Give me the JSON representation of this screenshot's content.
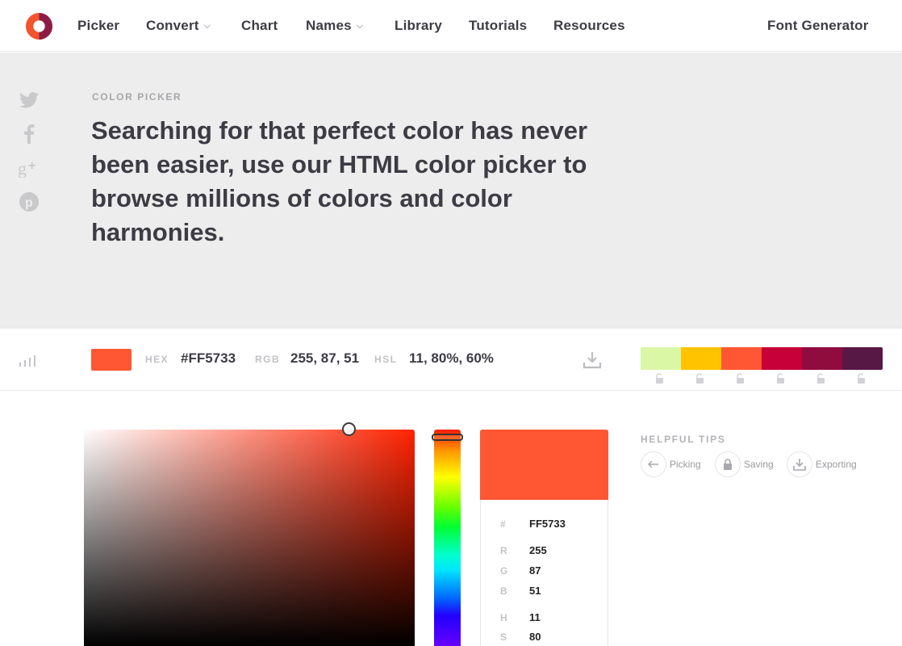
{
  "nav": {
    "items": [
      {
        "label": "Picker",
        "has_dropdown": false
      },
      {
        "label": "Convert",
        "has_dropdown": true
      },
      {
        "label": "Chart",
        "has_dropdown": false
      },
      {
        "label": "Names",
        "has_dropdown": true
      },
      {
        "label": "Library",
        "has_dropdown": false
      },
      {
        "label": "Tutorials",
        "has_dropdown": false
      },
      {
        "label": "Resources",
        "has_dropdown": false
      }
    ],
    "right_link": "Font Generator",
    "logo_icon": "logo-icon"
  },
  "social": [
    "twitter-icon",
    "facebook-icon",
    "google-plus-icon",
    "pinterest-icon"
  ],
  "hero": {
    "eyebrow": "COLOR PICKER",
    "headline": "Searching for that perfect color has never been easier, use our HTML color picker to browse millions of colors and color harmonies."
  },
  "current_color": {
    "hex_label": "HEX",
    "hex_value": "#FF5733",
    "rgb_label": "RGB",
    "rgb_value": "255, 87, 51",
    "hsl_label": "HSL",
    "hsl_value": "11, 80%, 60%",
    "swatch": "#FF5733"
  },
  "palette": [
    "#DAF7A6",
    "#FFC300",
    "#FF5733",
    "#C70039",
    "#900C3F",
    "#581845"
  ],
  "detail": {
    "swatch": "#FF5733",
    "rows": [
      {
        "label": "#",
        "value": "FF5733"
      },
      {
        "label": "R",
        "value": "255"
      },
      {
        "label": "G",
        "value": "87"
      },
      {
        "label": "B",
        "value": "51"
      },
      {
        "label": "H",
        "value": "11"
      },
      {
        "label": "S",
        "value": "80"
      }
    ]
  },
  "tips": {
    "title": "HELPFUL TIPS",
    "items": [
      {
        "label": "Picking",
        "icon": "arrow-left-icon"
      },
      {
        "label": "Saving",
        "icon": "lock-icon"
      },
      {
        "label": "Exporting",
        "icon": "download-icon"
      }
    ]
  },
  "colors": {
    "hero_bg": "#EDEDED",
    "logo_outer": "#F25C2A",
    "logo_inner": "#7C1F4A"
  }
}
